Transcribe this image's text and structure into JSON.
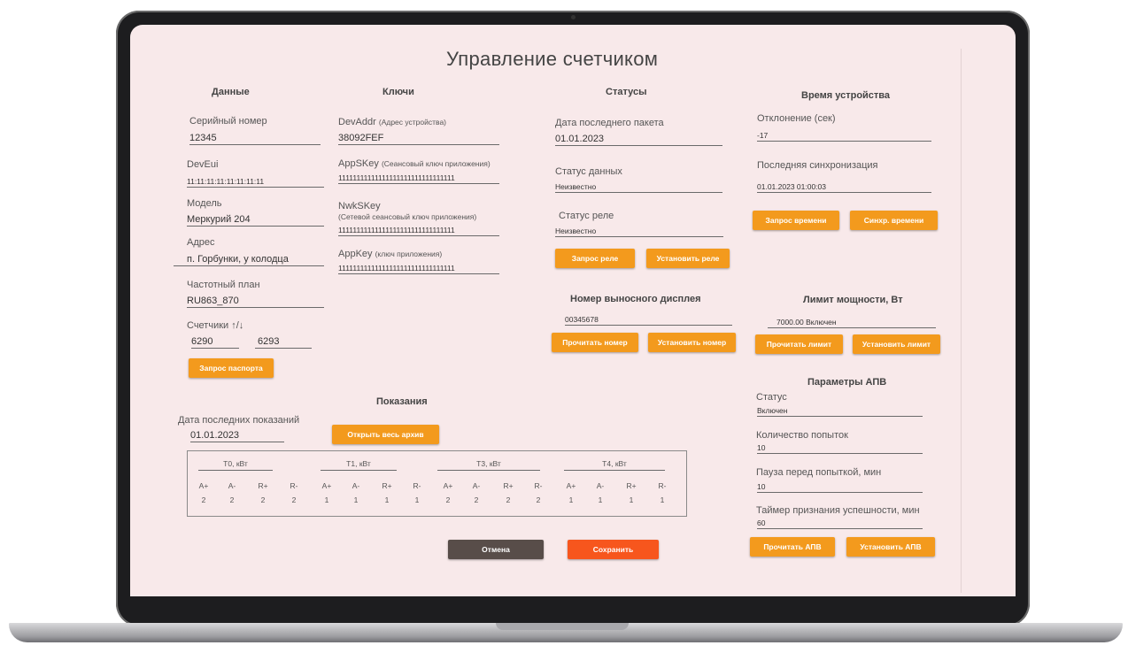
{
  "title": "Управление счетчиком",
  "data_section": {
    "heading": "Данные",
    "serial_label": "Серийный номер",
    "serial_value": "12345",
    "deveui_label": "DevEui",
    "deveui_value": "11:11:11:11:11:11:11:11",
    "model_label": "Модель",
    "model_value": "Меркурий 204",
    "address_label": "Адрес",
    "address_value": "п. Горбунки, у колодца",
    "freq_label": "Частотный план",
    "freq_value": "RU863_870",
    "counters_label": "Счетчики ↑/↓",
    "counter_up": "6290",
    "counter_down": "6293",
    "passport_button": "Запрос паспорта"
  },
  "keys_section": {
    "heading": "Ключи",
    "devaddr_label": "DevAddr",
    "devaddr_hint": "(Адрес устройства)",
    "devaddr_value": "38092FEF",
    "appskey_label": "AppSKey",
    "appskey_hint": "(Сеансовый ключ приложения)",
    "appskey_value": "11111111111111111111111111111111",
    "nwkskey_label": "NwkSKey",
    "nwkskey_hint": "(Сетевой сеансовый ключ приложения)",
    "nwkskey_value": "11111111111111111111111111111111",
    "appkey_label": "AppKey",
    "appkey_hint": "(ключ приложения)",
    "appkey_value": "11111111111111111111111111111111"
  },
  "status_section": {
    "heading": "Статусы",
    "last_packet_label": "Дата последнего пакета",
    "last_packet_value": "01.01.2023",
    "data_status_label": "Статус данных",
    "data_status_value": "Неизвестно",
    "relay_status_label": "Статус реле",
    "relay_status_value": "Неизвестно",
    "relay_request_button": "Запрос реле",
    "relay_set_button": "Установить реле"
  },
  "display_section": {
    "heading": "Номер выносного дисплея",
    "value": "00345678",
    "read_button": "Прочитать номер",
    "set_button": "Установить номер"
  },
  "time_section": {
    "heading": "Время устройства",
    "deviation_label": "Отклонение (сек)",
    "deviation_value": "-17",
    "last_sync_label": "Последняя синхронизация",
    "last_sync_value": "01.01.2023 01:00:03",
    "request_button": "Запрос времени",
    "sync_button": "Синхр. времени"
  },
  "power_section": {
    "heading": "Лимит мощности, Вт",
    "value": "7000.00 Включен",
    "read_button": "Прочитать лимит",
    "set_button": "Установить лимит"
  },
  "apv_section": {
    "heading": "Параметры АПВ",
    "status_label": "Статус",
    "status_value": "Включен",
    "attempts_label": "Количество попыток",
    "attempts_value": "10",
    "pause_label": "Пауза перед попыткой, мин",
    "pause_value": "10",
    "timer_label": "Таймер признания успешности, мин",
    "timer_value": "60",
    "read_button": "Прочитать АПВ",
    "set_button": "Установить АПВ"
  },
  "readings_section": {
    "heading": "Показания",
    "last_date_label": "Дата последних показаний",
    "last_date_value": "01.01.2023",
    "archive_button": "Открыть весь архив",
    "groups": [
      {
        "name": "T0, кВт",
        "headers": [
          "A+",
          "A-",
          "R+",
          "R-"
        ],
        "values": [
          "2",
          "2",
          "2",
          "2"
        ]
      },
      {
        "name": "T1, кВт",
        "headers": [
          "A+",
          "A-",
          "R+",
          "R-"
        ],
        "values": [
          "1",
          "1",
          "1",
          "1"
        ]
      },
      {
        "name": "T3, кВт",
        "headers": [
          "A+",
          "A-",
          "R+",
          "R-"
        ],
        "values": [
          "2",
          "2",
          "2",
          "2"
        ]
      },
      {
        "name": "T4, кВт",
        "headers": [
          "A+",
          "A-",
          "R+",
          "R-"
        ],
        "values": [
          "1",
          "1",
          "1",
          "1"
        ]
      }
    ]
  },
  "footer": {
    "cancel_button": "Отмена",
    "save_button": "Сохранить"
  },
  "colors": {
    "background": "#f8e9ea",
    "accent": "#f39a1d",
    "save": "#f7561d",
    "cancel": "#584d49"
  }
}
